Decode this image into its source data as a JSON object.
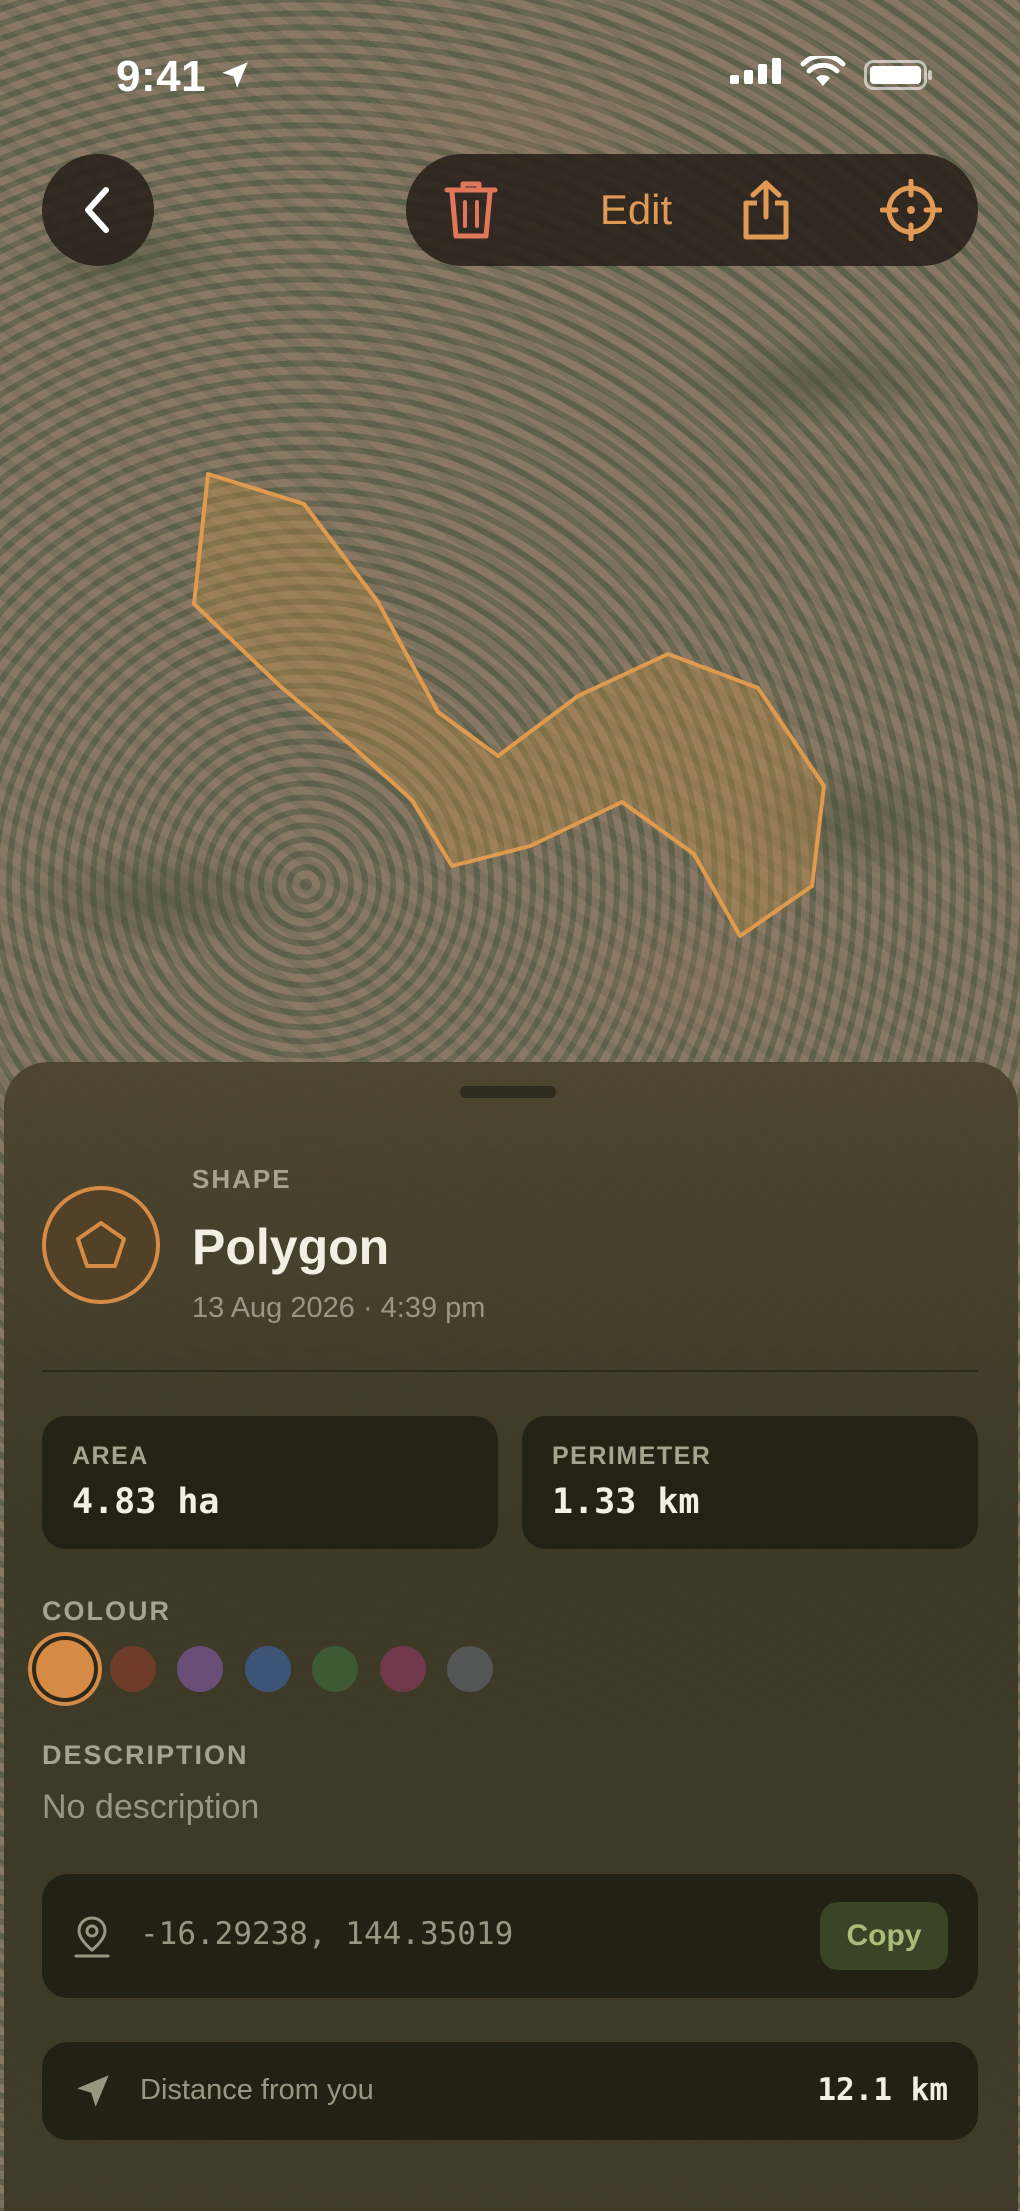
{
  "status_bar": {
    "time": "9:41"
  },
  "toolbar": {
    "edit_label": "Edit"
  },
  "sheet": {
    "shape_label": "SHAPE",
    "title": "Polygon",
    "date": "13 Aug 2026 · 4:39 pm",
    "stats": {
      "area_label": "AREA",
      "area_value": "4.83 ha",
      "perimeter_label": "PERIMETER",
      "perimeter_value": "1.33 km"
    },
    "colour": {
      "label": "COLOUR",
      "swatches": [
        "#d58a46",
        "#6e3c28",
        "#6a4e78",
        "#3e5478",
        "#3d5a35",
        "#70384a",
        "#545656"
      ],
      "selected_index": 0
    },
    "description": {
      "label": "DESCRIPTION",
      "text": "No description"
    },
    "coordinates": {
      "text": "-16.29238, 144.35019",
      "copy_label": "Copy"
    },
    "distance": {
      "label": "Distance from you",
      "value": "12.1 km"
    }
  },
  "colors": {
    "accent": "#d58a46",
    "polygon_stroke": "#e09a4e",
    "copy_text": "#a9bd7a"
  }
}
